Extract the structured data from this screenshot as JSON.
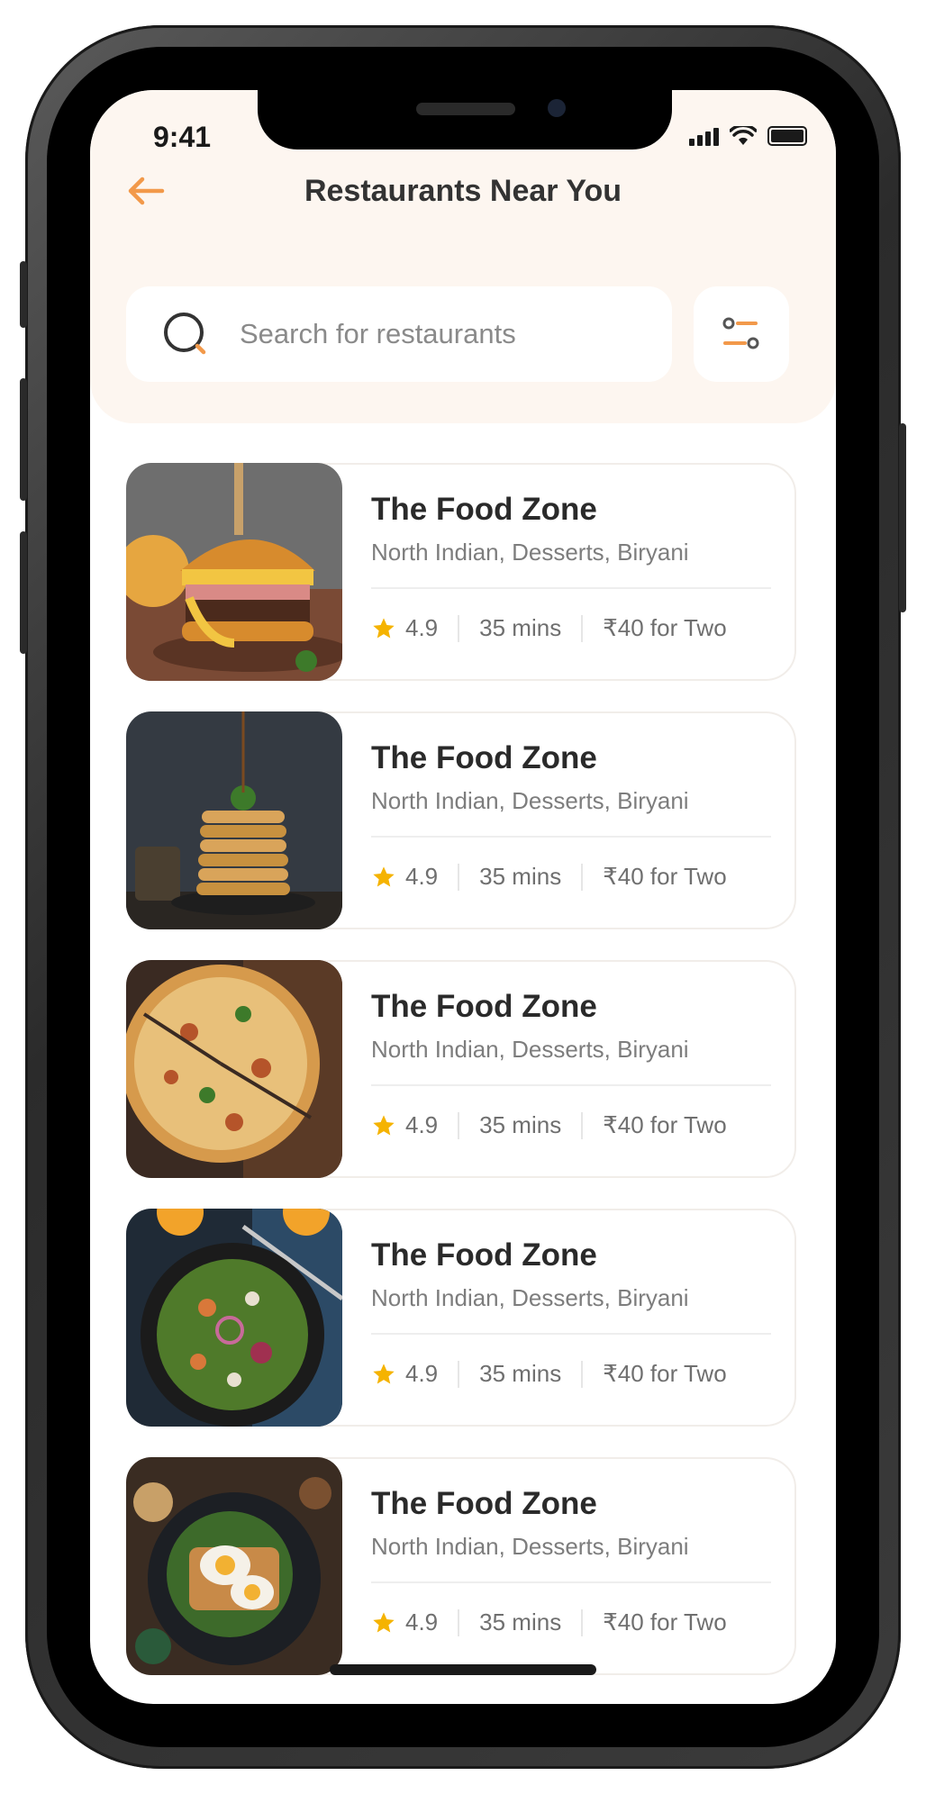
{
  "status_bar": {
    "time": "9:41"
  },
  "header": {
    "title": "Restaurants Near You"
  },
  "search": {
    "placeholder": "Search for restaurants"
  },
  "colors": {
    "accent": "#f2994a",
    "star": "#f5b301",
    "header_bg": "#fdf6f0"
  },
  "restaurants": [
    {
      "name": "The Food Zone",
      "cuisine": "North Indian, Desserts, Biryani",
      "rating": "4.9",
      "time": "35 mins",
      "price": "₹40 for Two",
      "image": "burger"
    },
    {
      "name": "The Food Zone",
      "cuisine": "North Indian, Desserts, Biryani",
      "rating": "4.9",
      "time": "35 mins",
      "price": "₹40 for Two",
      "image": "pancakes"
    },
    {
      "name": "The Food Zone",
      "cuisine": "North Indian, Desserts, Biryani",
      "rating": "4.9",
      "time": "35 mins",
      "price": "₹40 for Two",
      "image": "pizza"
    },
    {
      "name": "The Food Zone",
      "cuisine": "North Indian, Desserts, Biryani",
      "rating": "4.9",
      "time": "35 mins",
      "price": "₹40 for Two",
      "image": "salad"
    },
    {
      "name": "The Food Zone",
      "cuisine": "North Indian, Desserts, Biryani",
      "rating": "4.9",
      "time": "35 mins",
      "price": "₹40 for Two",
      "image": "egg-toast"
    }
  ],
  "icons": [
    "back-arrow-icon",
    "search-icon",
    "filter-icon",
    "star-icon",
    "signal-icon",
    "wifi-icon",
    "battery-icon"
  ]
}
